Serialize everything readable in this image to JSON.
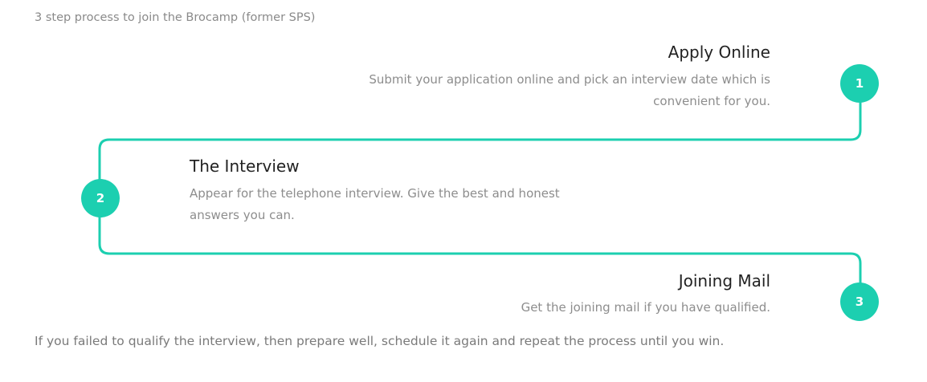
{
  "intro_text": "3 step process to join the Brocamp (former SPS)",
  "steps": [
    {
      "number": "1",
      "title": "Apply Online",
      "description": "Submit your application online and pick an interview date which is convenient for you."
    },
    {
      "number": "2",
      "title": "The Interview",
      "description": "Appear for the telephone interview. Give the best and honest answers you can."
    },
    {
      "number": "3",
      "title": "Joining Mail",
      "description": "Get the joining mail if you have qualified."
    }
  ],
  "footer_text": "If you failed to qualify the interview, then prepare well, schedule it again and repeat the process until you win.",
  "colors": {
    "accent": "#1ccfb0",
    "title": "#222222",
    "body_text": "#8d8d8d"
  }
}
